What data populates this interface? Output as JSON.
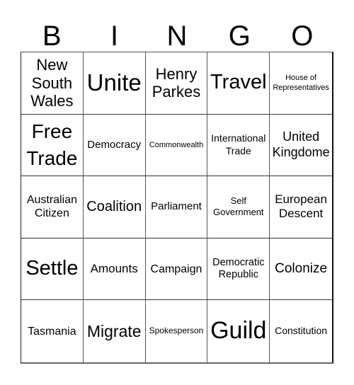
{
  "header": {
    "letters": [
      "B",
      "I",
      "N",
      "G",
      "O"
    ]
  },
  "card": {
    "rows": [
      [
        "New South Wales",
        "Unite",
        "Henry Parkes",
        "Travel",
        "House of Representatives"
      ],
      [
        "Free Trade",
        "Democracy",
        "Commonwealth",
        "International Trade",
        "United Kingdome"
      ],
      [
        "Australian Citizen",
        "Coalition",
        "Parliament",
        "Self Government",
        "European Descent"
      ],
      [
        "Settle",
        "Amounts",
        "Campaign",
        "Democratic Republic",
        "Colonize"
      ],
      [
        "Tasmania",
        "Migrate",
        "Spokesperson",
        "Guild",
        "Constitution"
      ]
    ]
  }
}
